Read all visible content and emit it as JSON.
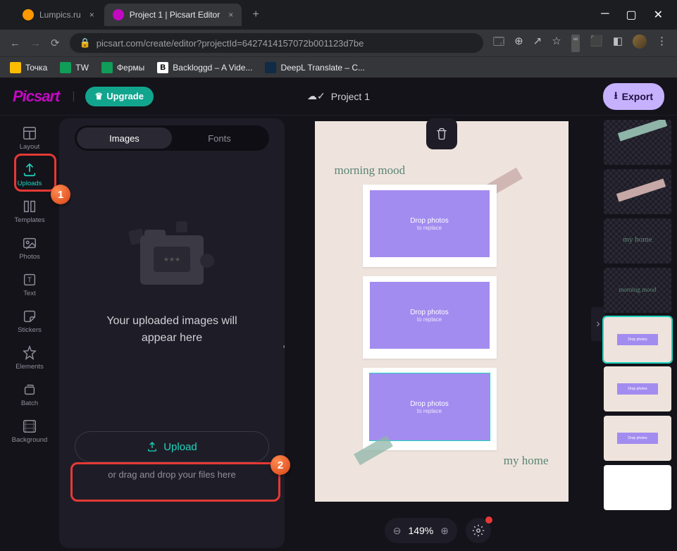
{
  "browser": {
    "tabs": [
      {
        "title": "Lumpics.ru",
        "active": false,
        "favicon": "#ff9800"
      },
      {
        "title": "Project 1 | Picsart Editor",
        "active": true,
        "favicon": "#c209c1"
      }
    ],
    "url": "picsart.com/create/editor?projectId=6427414157072b001123d7be",
    "bookmarks": [
      {
        "label": "Точка",
        "color": "#fbbc04"
      },
      {
        "label": "TW",
        "color": "#0f9d58"
      },
      {
        "label": "Фермы",
        "color": "#0f9d58"
      },
      {
        "label": "Backloggd – A Vide...",
        "color": "#ffffff"
      },
      {
        "label": "DeepL Translate – С...",
        "color": "#0f2b46"
      }
    ]
  },
  "app": {
    "logo": "Picsart",
    "upgrade": "Upgrade",
    "project_title": "Project 1",
    "export": "Export"
  },
  "left_rail": [
    {
      "label": "Layout",
      "id": "layout"
    },
    {
      "label": "Uploads",
      "id": "uploads",
      "active": true
    },
    {
      "label": "Templates",
      "id": "templates"
    },
    {
      "label": "Photos",
      "id": "photos"
    },
    {
      "label": "Text",
      "id": "text"
    },
    {
      "label": "Stickers",
      "id": "stickers"
    },
    {
      "label": "Elements",
      "id": "elements"
    },
    {
      "label": "Batch",
      "id": "batch"
    },
    {
      "label": "Background",
      "id": "background"
    }
  ],
  "upload_panel": {
    "tabs": {
      "images": "Images",
      "fonts": "Fonts"
    },
    "empty_text_1": "Your uploaded images will",
    "empty_text_2": "appear here",
    "upload_button": "Upload",
    "drag_text": "or drag and drop your files here"
  },
  "canvas": {
    "heading1": "morning mood",
    "heading2": "my home",
    "drop_title": "Drop photos",
    "drop_sub": "to replace"
  },
  "thumbs": {
    "t4_text": "my home",
    "t5_text": "morning mood",
    "mini_drop": "Drop photos"
  },
  "zoom": {
    "value": "149%"
  },
  "annotations": {
    "step1": "1",
    "step2": "2"
  }
}
